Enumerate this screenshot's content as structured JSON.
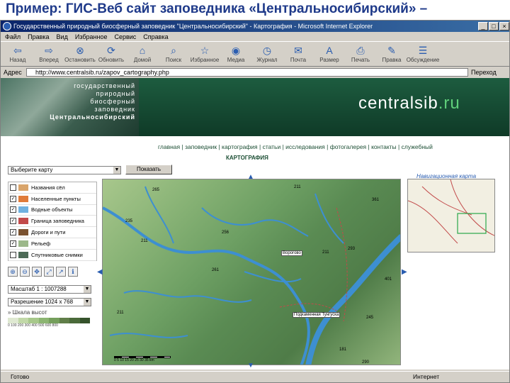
{
  "slide_title": "Пример: ГИС-Веб сайт заповедника «Центральносибирский» –",
  "window": {
    "title": "Государственный природный биосферный заповедник \"Центральносибирский\" - Картография - Microsoft Internet Explorer",
    "minimize": "_",
    "maximize": "□",
    "close": "×"
  },
  "menu": [
    "Файл",
    "Правка",
    "Вид",
    "Избранное",
    "Сервис",
    "Справка"
  ],
  "toolbar": [
    {
      "label": "Назад",
      "icon": "back-arrow-icon",
      "glyph": "⇦"
    },
    {
      "label": "Вперед",
      "icon": "forward-arrow-icon",
      "glyph": "⇨"
    },
    {
      "label": "Остановить",
      "icon": "stop-icon",
      "glyph": "⊗"
    },
    {
      "label": "Обновить",
      "icon": "refresh-icon",
      "glyph": "⟳"
    },
    {
      "label": "Домой",
      "icon": "home-icon",
      "glyph": "⌂"
    },
    {
      "label": "Поиск",
      "icon": "search-icon",
      "glyph": "⌕"
    },
    {
      "label": "Избранное",
      "icon": "favorites-icon",
      "glyph": "☆"
    },
    {
      "label": "Медиа",
      "icon": "media-icon",
      "glyph": "◉"
    },
    {
      "label": "Журнал",
      "icon": "history-icon",
      "glyph": "◷"
    },
    {
      "label": "Почта",
      "icon": "mail-icon",
      "glyph": "✉"
    },
    {
      "label": "Размер",
      "icon": "font-size-icon",
      "glyph": "A"
    },
    {
      "label": "Печать",
      "icon": "print-icon",
      "glyph": "⎙"
    },
    {
      "label": "Правка",
      "icon": "edit-icon",
      "glyph": "✎"
    },
    {
      "label": "Обсуждение",
      "icon": "discuss-icon",
      "glyph": "☰"
    }
  ],
  "address": {
    "label": "Адрес",
    "url": "http://www.centralsib.ru/zapov_cartography.php",
    "go": "Переход"
  },
  "site": {
    "header_lines": [
      "государственный",
      "природный",
      "биосферный",
      "заповедник",
      "Центральносибирский"
    ],
    "brand_main": "centralsib",
    "brand_tld": ".ru",
    "nav": "главная | заповедник | картография | статьи | исследования | фотогалерея | контакты | служебный",
    "section_title": "КАРТОГРАФИЯ"
  },
  "controls": {
    "select_map": "Выберите карту",
    "show_button": "Показать",
    "nav_map_label": "Навигационная карта",
    "layers": [
      {
        "label": "Названия сёл",
        "checked": false
      },
      {
        "label": "Населенные пункты",
        "checked": true
      },
      {
        "label": "Водные объекты",
        "checked": true
      },
      {
        "label": "Граница заповедника",
        "checked": true
      },
      {
        "label": "Дороги и пути",
        "checked": true
      },
      {
        "label": "Рельеф",
        "checked": true
      },
      {
        "label": "Спутниковые снимки",
        "checked": false
      }
    ],
    "refresh_label": "Обновить",
    "scale": "Масштаб 1 : 1007288",
    "resolution": "Разрешение 1024 x 768",
    "height_label": "» Шкала высот",
    "height_ticks": "0  100  200  300  400  500  600  800",
    "height_colors": [
      "#dfe9d2",
      "#c1d8a8",
      "#a7c88b",
      "#8cb572",
      "#759f5c",
      "#607e49",
      "#4a6a3a",
      "#35522b"
    ]
  },
  "map": {
    "labels": [
      "265",
      "235",
      "211",
      "361",
      "256",
      "261",
      "211",
      "293",
      "211",
      "245",
      "181",
      "290",
      "401",
      "211"
    ],
    "town_vorogovo": "Ворогово",
    "town_label2": "Подкаменная Тунгуска",
    "scale_ticks": "0  5  10  15  20  25  30  35 km"
  },
  "status": {
    "left": "Готово",
    "zone": "Интернет"
  }
}
